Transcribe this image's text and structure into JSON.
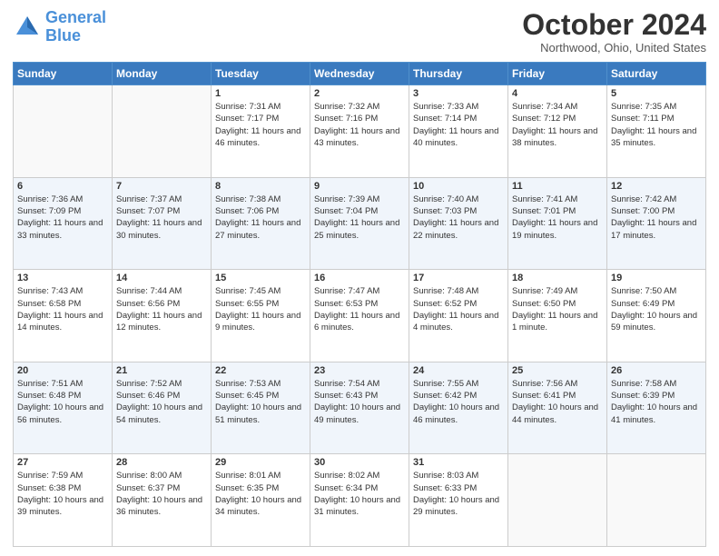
{
  "header": {
    "logo_line1": "General",
    "logo_line2": "Blue",
    "month": "October 2024",
    "location": "Northwood, Ohio, United States"
  },
  "weekdays": [
    "Sunday",
    "Monday",
    "Tuesday",
    "Wednesday",
    "Thursday",
    "Friday",
    "Saturday"
  ],
  "weeks": [
    [
      {
        "day": "",
        "info": ""
      },
      {
        "day": "",
        "info": ""
      },
      {
        "day": "1",
        "info": "Sunrise: 7:31 AM\nSunset: 7:17 PM\nDaylight: 11 hours and 46 minutes."
      },
      {
        "day": "2",
        "info": "Sunrise: 7:32 AM\nSunset: 7:16 PM\nDaylight: 11 hours and 43 minutes."
      },
      {
        "day": "3",
        "info": "Sunrise: 7:33 AM\nSunset: 7:14 PM\nDaylight: 11 hours and 40 minutes."
      },
      {
        "day": "4",
        "info": "Sunrise: 7:34 AM\nSunset: 7:12 PM\nDaylight: 11 hours and 38 minutes."
      },
      {
        "day": "5",
        "info": "Sunrise: 7:35 AM\nSunset: 7:11 PM\nDaylight: 11 hours and 35 minutes."
      }
    ],
    [
      {
        "day": "6",
        "info": "Sunrise: 7:36 AM\nSunset: 7:09 PM\nDaylight: 11 hours and 33 minutes."
      },
      {
        "day": "7",
        "info": "Sunrise: 7:37 AM\nSunset: 7:07 PM\nDaylight: 11 hours and 30 minutes."
      },
      {
        "day": "8",
        "info": "Sunrise: 7:38 AM\nSunset: 7:06 PM\nDaylight: 11 hours and 27 minutes."
      },
      {
        "day": "9",
        "info": "Sunrise: 7:39 AM\nSunset: 7:04 PM\nDaylight: 11 hours and 25 minutes."
      },
      {
        "day": "10",
        "info": "Sunrise: 7:40 AM\nSunset: 7:03 PM\nDaylight: 11 hours and 22 minutes."
      },
      {
        "day": "11",
        "info": "Sunrise: 7:41 AM\nSunset: 7:01 PM\nDaylight: 11 hours and 19 minutes."
      },
      {
        "day": "12",
        "info": "Sunrise: 7:42 AM\nSunset: 7:00 PM\nDaylight: 11 hours and 17 minutes."
      }
    ],
    [
      {
        "day": "13",
        "info": "Sunrise: 7:43 AM\nSunset: 6:58 PM\nDaylight: 11 hours and 14 minutes."
      },
      {
        "day": "14",
        "info": "Sunrise: 7:44 AM\nSunset: 6:56 PM\nDaylight: 11 hours and 12 minutes."
      },
      {
        "day": "15",
        "info": "Sunrise: 7:45 AM\nSunset: 6:55 PM\nDaylight: 11 hours and 9 minutes."
      },
      {
        "day": "16",
        "info": "Sunrise: 7:47 AM\nSunset: 6:53 PM\nDaylight: 11 hours and 6 minutes."
      },
      {
        "day": "17",
        "info": "Sunrise: 7:48 AM\nSunset: 6:52 PM\nDaylight: 11 hours and 4 minutes."
      },
      {
        "day": "18",
        "info": "Sunrise: 7:49 AM\nSunset: 6:50 PM\nDaylight: 11 hours and 1 minute."
      },
      {
        "day": "19",
        "info": "Sunrise: 7:50 AM\nSunset: 6:49 PM\nDaylight: 10 hours and 59 minutes."
      }
    ],
    [
      {
        "day": "20",
        "info": "Sunrise: 7:51 AM\nSunset: 6:48 PM\nDaylight: 10 hours and 56 minutes."
      },
      {
        "day": "21",
        "info": "Sunrise: 7:52 AM\nSunset: 6:46 PM\nDaylight: 10 hours and 54 minutes."
      },
      {
        "day": "22",
        "info": "Sunrise: 7:53 AM\nSunset: 6:45 PM\nDaylight: 10 hours and 51 minutes."
      },
      {
        "day": "23",
        "info": "Sunrise: 7:54 AM\nSunset: 6:43 PM\nDaylight: 10 hours and 49 minutes."
      },
      {
        "day": "24",
        "info": "Sunrise: 7:55 AM\nSunset: 6:42 PM\nDaylight: 10 hours and 46 minutes."
      },
      {
        "day": "25",
        "info": "Sunrise: 7:56 AM\nSunset: 6:41 PM\nDaylight: 10 hours and 44 minutes."
      },
      {
        "day": "26",
        "info": "Sunrise: 7:58 AM\nSunset: 6:39 PM\nDaylight: 10 hours and 41 minutes."
      }
    ],
    [
      {
        "day": "27",
        "info": "Sunrise: 7:59 AM\nSunset: 6:38 PM\nDaylight: 10 hours and 39 minutes."
      },
      {
        "day": "28",
        "info": "Sunrise: 8:00 AM\nSunset: 6:37 PM\nDaylight: 10 hours and 36 minutes."
      },
      {
        "day": "29",
        "info": "Sunrise: 8:01 AM\nSunset: 6:35 PM\nDaylight: 10 hours and 34 minutes."
      },
      {
        "day": "30",
        "info": "Sunrise: 8:02 AM\nSunset: 6:34 PM\nDaylight: 10 hours and 31 minutes."
      },
      {
        "day": "31",
        "info": "Sunrise: 8:03 AM\nSunset: 6:33 PM\nDaylight: 10 hours and 29 minutes."
      },
      {
        "day": "",
        "info": ""
      },
      {
        "day": "",
        "info": ""
      }
    ]
  ]
}
